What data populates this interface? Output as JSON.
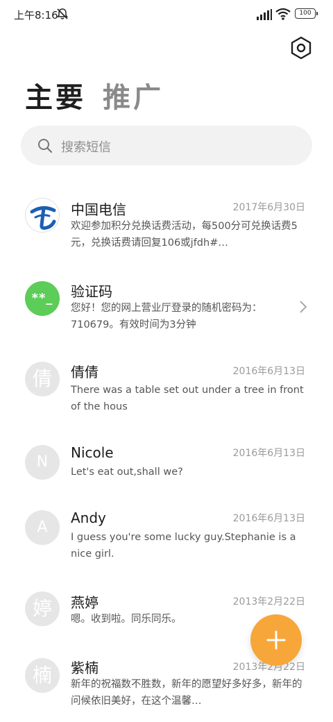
{
  "status_bar": {
    "time": "上午8:16",
    "battery": "100",
    "icons": [
      "mute-icon",
      "signal-icon",
      "wifi-icon",
      "battery-icon"
    ]
  },
  "header": {
    "settings_icon": "hexagon-settings-icon",
    "tabs": [
      {
        "label": "主要",
        "active": true
      },
      {
        "label": "推广",
        "active": false
      }
    ]
  },
  "search": {
    "placeholder": "搜索短信",
    "icon": "search-icon"
  },
  "messages": [
    {
      "name": "中国电信",
      "date": "2017年6月30日",
      "preview": "欢迎参加积分兑换话费活动，每500分可兑换话费5元，兑换话费请回复106或jfdh#…",
      "avatar": ""
    },
    {
      "name": "验证码",
      "date": "",
      "preview": "您好！您的网上营业厅登录的随机密码为：710679。有效时间为3分钟",
      "avatar": "**_"
    },
    {
      "name": "倩倩",
      "date": "2016年6月13日",
      "preview": "There was a table set out under a tree in front of the hous",
      "avatar": "倩"
    },
    {
      "name": "Nicole",
      "date": "2016年6月13日",
      "preview": "Let's eat out,shall we?",
      "avatar": "N"
    },
    {
      "name": "Andy",
      "date": "2016年6月13日",
      "preview": "I guess you're some lucky guy.Stephanie is a nice girl.",
      "avatar": "A"
    },
    {
      "name": "燕婷",
      "date": "2013年2月22日",
      "preview": "嗯。收到啦。同乐同乐。",
      "avatar": "婷"
    },
    {
      "name": "紫楠",
      "date": "2013年2月22日",
      "preview": "新年的祝福数不胜数，新年的愿望好多好多，新年的问候依旧美好，在这个温馨…",
      "avatar": "楠"
    }
  ],
  "colors": {
    "fab": "#f7a63a",
    "verify_avatar": "#5bcd58",
    "telecom_blue": "#1a5fb4",
    "avatar_gray": "#e6e6e6"
  },
  "fab": {
    "icon": "plus-icon"
  }
}
